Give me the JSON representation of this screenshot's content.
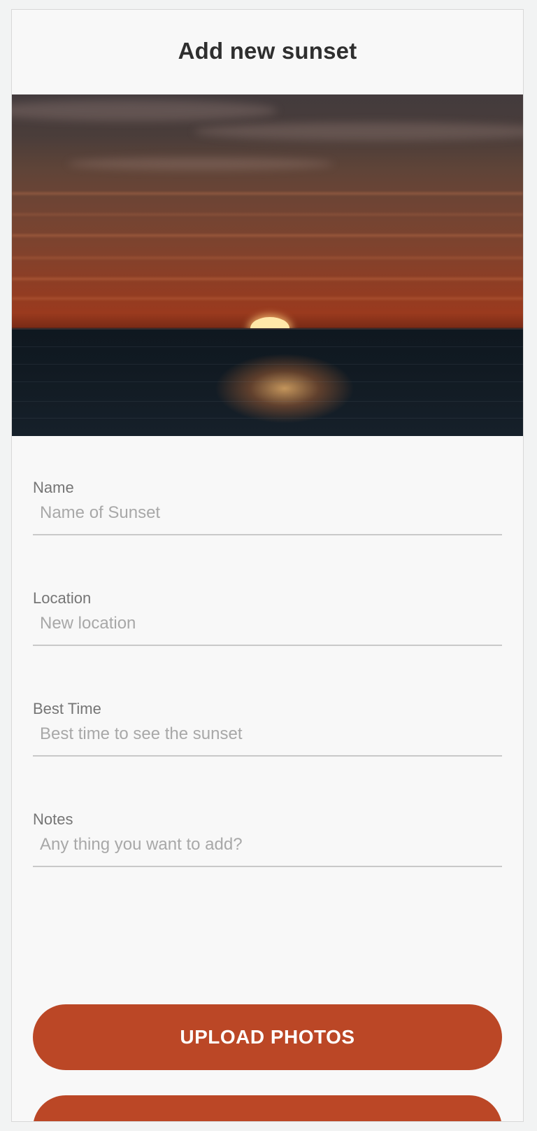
{
  "header": {
    "title": "Add new sunset"
  },
  "hero": {
    "image_description_icon": "sunset-photo",
    "accent_color": "#bb4726"
  },
  "form": {
    "fields": [
      {
        "label": "Name",
        "placeholder": "Name of Sunset",
        "value": ""
      },
      {
        "label": "Location",
        "placeholder": "New location",
        "value": ""
      },
      {
        "label": "Best Time",
        "placeholder": "Best time to see the sunset",
        "value": ""
      },
      {
        "label": "Notes",
        "placeholder": "Any thing you want to add?",
        "value": ""
      }
    ]
  },
  "actions": {
    "upload_label": "UPLOAD PHOTOS",
    "second_label": "",
    "button_color": "#bb4726"
  }
}
